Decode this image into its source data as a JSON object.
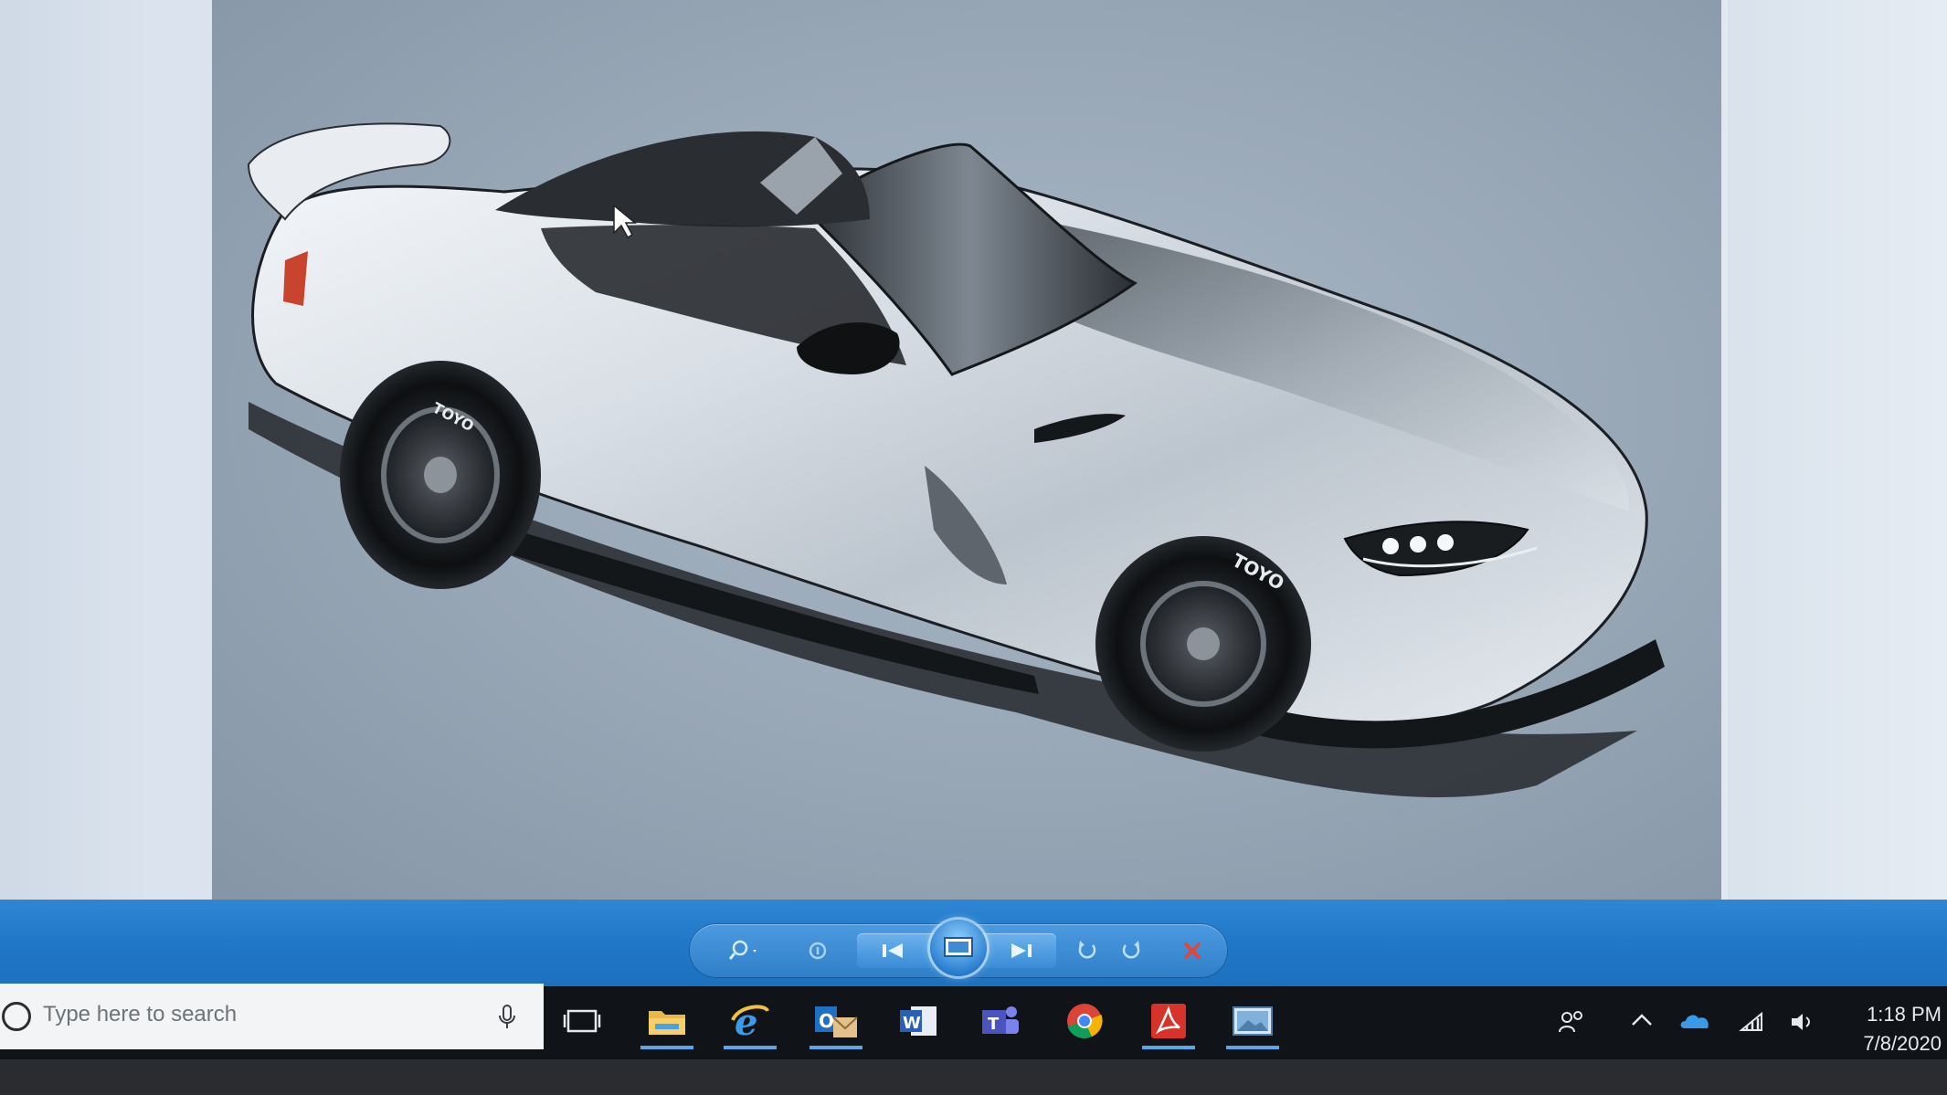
{
  "viewer": {
    "image_subject": "car-render",
    "tire_brand_rear": "TOYO",
    "tire_brand_front": "TOYO",
    "controls": [
      {
        "name": "zoom",
        "icon": "magnifier-icon"
      },
      {
        "name": "actual-size",
        "icon": "actual-size-icon"
      },
      {
        "name": "previous",
        "icon": "previous-icon"
      },
      {
        "name": "slideshow",
        "icon": "slideshow-icon"
      },
      {
        "name": "next",
        "icon": "next-icon"
      },
      {
        "name": "rotate-counterclockwise",
        "icon": "rotate-ccw-icon"
      },
      {
        "name": "rotate-clockwise",
        "icon": "rotate-cw-icon"
      },
      {
        "name": "delete",
        "icon": "delete-icon"
      }
    ],
    "accent_color": "#2178c8"
  },
  "taskbar": {
    "search_placeholder": "Type here to search",
    "apps": [
      {
        "name": "task-view",
        "icon": "task-view-icon"
      },
      {
        "name": "file-explorer",
        "icon": "folder-icon",
        "running": true
      },
      {
        "name": "internet-explorer",
        "icon": "ie-icon",
        "running": true
      },
      {
        "name": "outlook",
        "icon": "outlook-icon",
        "running": true
      },
      {
        "name": "word",
        "icon": "word-icon"
      },
      {
        "name": "teams",
        "icon": "teams-icon"
      },
      {
        "name": "chrome",
        "icon": "chrome-icon"
      },
      {
        "name": "acrobat",
        "icon": "acrobat-icon",
        "running": true
      },
      {
        "name": "photo-viewer",
        "icon": "photo-viewer-icon",
        "running": true
      }
    ],
    "tray": {
      "icons": [
        "people-icon",
        "chevron-up-icon",
        "onedrive-icon",
        "wifi-icon",
        "volume-icon"
      ]
    },
    "clock": {
      "time": "1:18 PM",
      "date": "7/8/2020"
    }
  }
}
